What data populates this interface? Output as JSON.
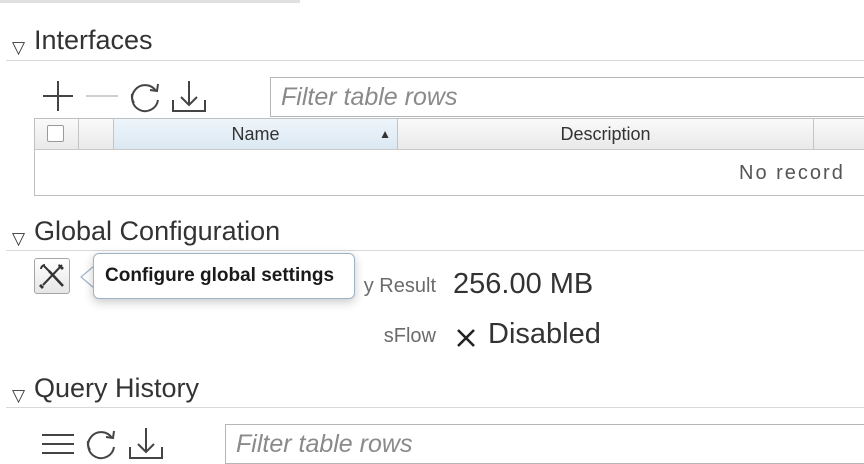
{
  "interfaces": {
    "title": "Interfaces",
    "toolbar": {
      "add_icon": "plus-icon",
      "remove_icon": "minus-icon",
      "refresh_icon": "refresh-icon",
      "download_icon": "download-icon"
    },
    "filter_placeholder": "Filter table rows",
    "columns": [
      "Name",
      "Description"
    ],
    "sorted_column": "Name",
    "sort_direction": "ascending",
    "empty_text": "No record"
  },
  "global_configuration": {
    "title": "Global Configuration",
    "settings_icon": "tools-icon",
    "tooltip": "Configure global settings",
    "fields": [
      {
        "label": "y Result",
        "value": "256.00 MB"
      },
      {
        "label": "sFlow",
        "value": "Disabled",
        "value_icon": "x-icon"
      }
    ]
  },
  "query_history": {
    "title": "Query History",
    "toolbar": {
      "menu_icon": "list-icon",
      "refresh_icon": "refresh-icon",
      "download_icon": "download-icon"
    },
    "filter_placeholder": "Filter table rows"
  },
  "colors": {
    "header_sorted_bg": "#dbe8f2",
    "tooltip_border": "#9fb3c8",
    "text": "#333333"
  }
}
